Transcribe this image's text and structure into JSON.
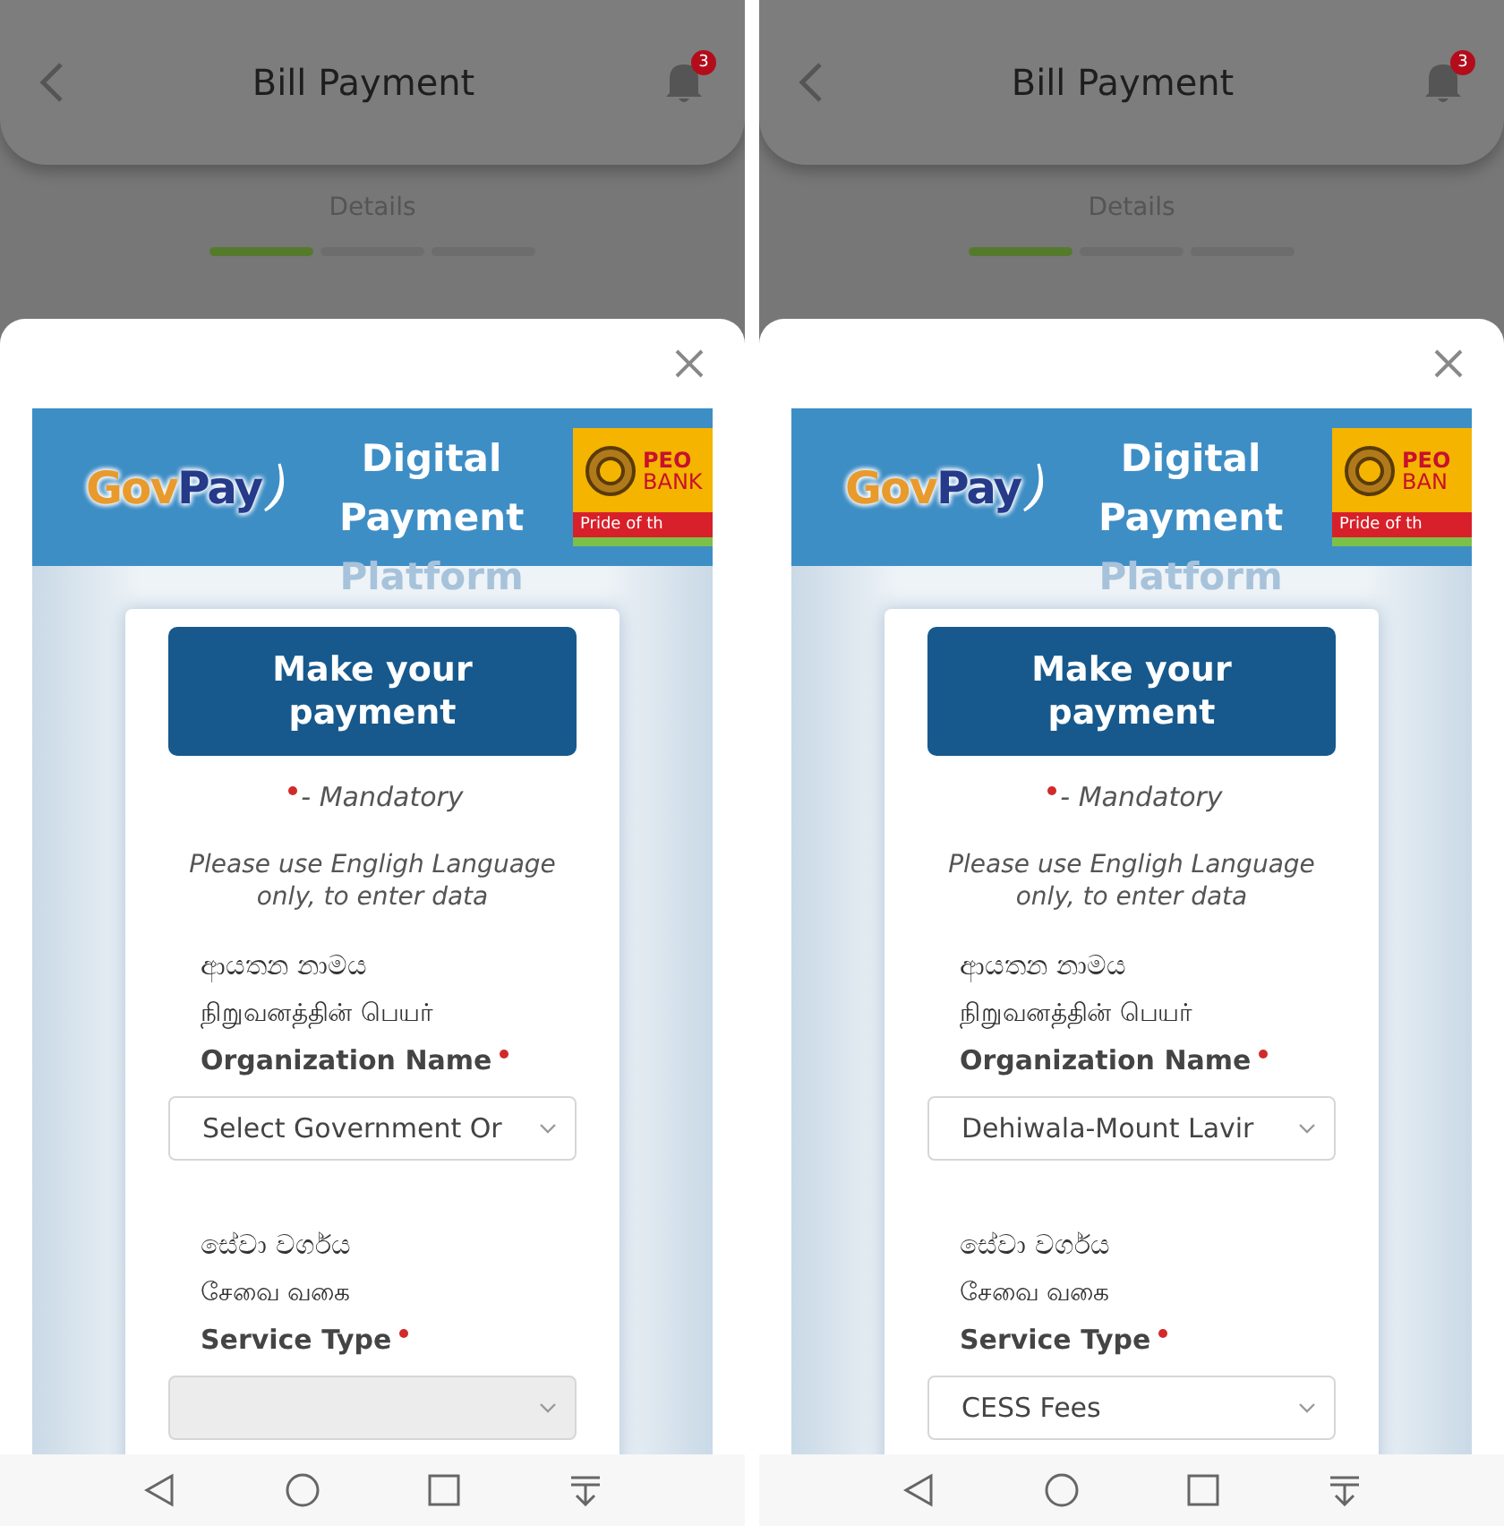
{
  "screens": [
    {
      "header": {
        "title": "Bill Payment",
        "notification_count": "3"
      },
      "step": {
        "label": "Details",
        "segments": [
          {
            "done": true
          },
          {
            "done": false
          },
          {
            "done": false
          }
        ]
      },
      "banner": {
        "logo": [
          "Gov",
          "Pay"
        ],
        "title_lines": [
          "Digital",
          "Payment",
          "Platform"
        ],
        "bank": {
          "name_lines": [
            "PEO",
            "BANK"
          ],
          "tagline": "Pride of th"
        }
      },
      "form": {
        "heading": "Make your payment",
        "mandatory_note": "- Mandatory",
        "instruction": "Please use Engligh Language only, to enter data",
        "fields": [
          {
            "labels": [
              "ආයතන නාමය",
              "நிறுவனத்தின் பெயர்"
            ],
            "label": "Organization Name",
            "required": true,
            "disabled": false,
            "value": "Select Government Or"
          },
          {
            "labels": [
              "සේවා වර්ගය",
              "சேவை வகை"
            ],
            "label": "Service Type",
            "required": true,
            "disabled": true
          }
        ]
      }
    },
    {
      "header": {
        "title": "Bill Payment",
        "notification_count": "3"
      },
      "step": {
        "label": "Details",
        "segments": [
          {
            "done": true
          },
          {
            "done": false
          },
          {
            "done": false
          }
        ]
      },
      "banner": {
        "logo": [
          "Gov",
          "Pay"
        ],
        "title_lines": [
          "Digital",
          "Payment",
          "Platform"
        ],
        "bank": {
          "name_lines": [
            "PEO",
            "BAN"
          ],
          "tagline": "Pride of th"
        }
      },
      "form": {
        "heading": "Make your payment",
        "mandatory_note": "- Mandatory",
        "instruction": "Please use Engligh Language only, to enter data",
        "fields": [
          {
            "labels": [
              "ආයතන නාමය",
              "நிறுவனத்தின் பெயர்"
            ],
            "label": "Organization Name",
            "required": true,
            "disabled": false,
            "value": "Dehiwala-Mount Lavir"
          },
          {
            "labels": [
              "සේවා වර්ගය",
              "சேவை வகை"
            ],
            "label": "Service Type",
            "required": true,
            "disabled": false,
            "value": "CESS Fees"
          }
        ]
      }
    }
  ]
}
